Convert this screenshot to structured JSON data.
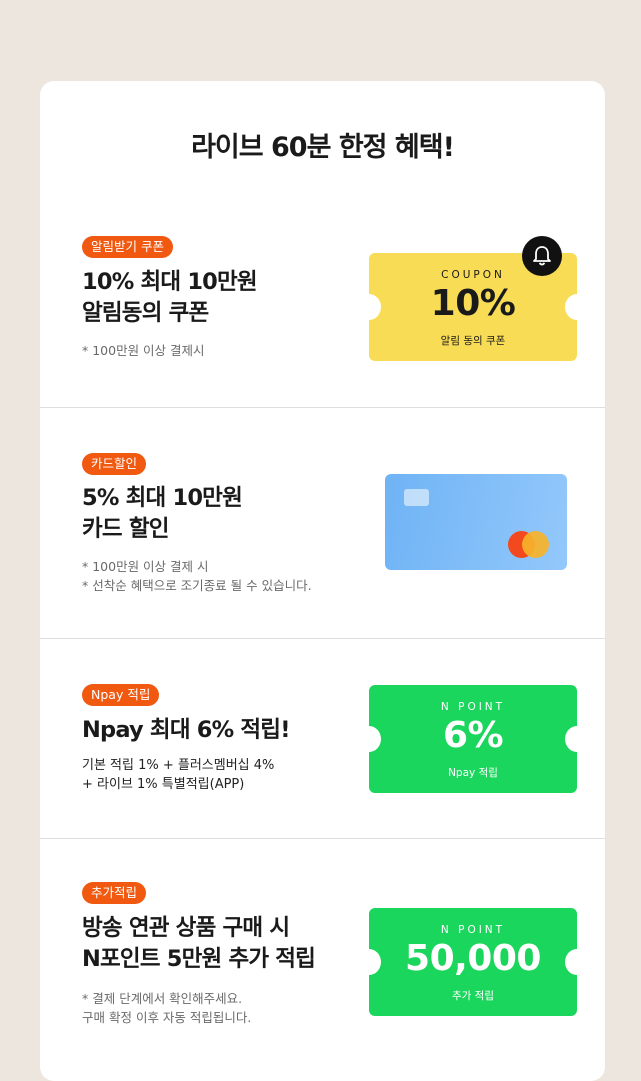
{
  "title": "라이브 60분 한정 혜택!",
  "benefits": [
    {
      "badge": "알림받기 쿠폰",
      "heading": "10% 최대 10만원\n알림동의 쿠폰",
      "notes": "* 100만원 이상 결제시",
      "coupon": {
        "label": "COUPON",
        "value": "10%",
        "sub": "알림 동의 쿠폰",
        "icon": "bell-icon",
        "color": "#f8dc55"
      }
    },
    {
      "badge": "카드할인",
      "heading": "5% 최대 10만원\n카드 할인",
      "notes": "* 100만원 이상 결제 시\n* 선착순 혜택으로 조기종료 될 수 있습니다.",
      "card": {
        "icon": "credit-card-icon",
        "color": "#7fbaf7"
      }
    },
    {
      "badge": "Npay 적립",
      "heading": "Npay 최대 6% 적립!",
      "notes": "기본 적립 1% + 플러스멤버십 4%\n+ 라이브 1% 특별적립(APP)",
      "coupon": {
        "label": "N POINT",
        "value": "6%",
        "sub": "Npay 적립",
        "color": "#1ad65c"
      }
    },
    {
      "badge": "추가적립",
      "heading": "방송 연관 상품 구매 시\nN포인트 5만원 추가 적립",
      "notes": "* 결제 단계에서 확인해주세요.\n   구매 확정 이후 자동 적립됩니다.",
      "coupon": {
        "label": "N POINT",
        "value": "50,000",
        "sub": "추가 적립",
        "color": "#1ad65c"
      }
    }
  ],
  "colors": {
    "badge": "#f0590f",
    "background": "#ece6df"
  }
}
